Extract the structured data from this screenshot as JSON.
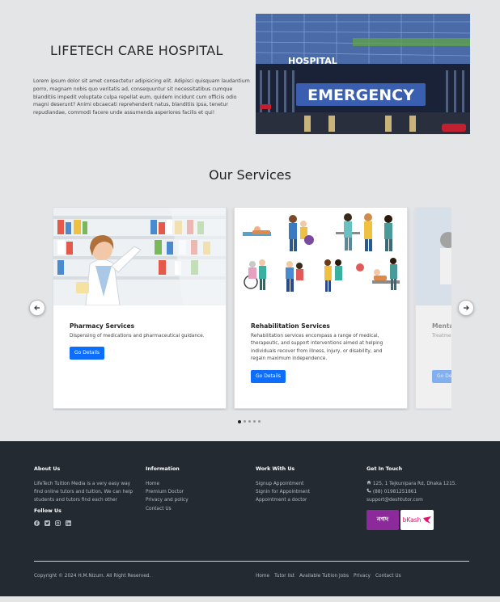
{
  "hero": {
    "title": "LIFETECH CARE HOSPITAL",
    "text": "Lorem ipsum dolor sit amet consectetur adipisicing elit. Adipisci quisquam laudantium porro, magnam nobis quo veritatis ad, consequuntur sit necessitatibus cumque blanditiis impedit voluptate culpa repellat eum, quidem incidunt cum officiis odio magni deserunt? Animi obcaecati reprehenderit natus, blanditiis ipsa, tenetur repudiandae, commodi facere unde assumenda asperiores facilis et qui!",
    "image_sign_top": "HOSPITAL",
    "image_sign_main": "EMERGENCY"
  },
  "services": {
    "title": "Our Services",
    "cards": [
      {
        "title": "Pharmacy Services",
        "description": "Dispensing of medications and pharmaceutical guidance.",
        "button": "Go Details"
      },
      {
        "title": "Rehabilitation Services",
        "description": "Rehabilitation services encompass a range of medical, therapeutic, and support interventions aimed at helping individuals recover from illness, injury, or disability, and regain maximum independence.",
        "button": "Go Details"
      },
      {
        "title": "Mental",
        "description": "Treatment Certainly profession mental h",
        "button": "Go Det"
      }
    ],
    "dot_count": 5,
    "active_dot": 0
  },
  "footer": {
    "about": {
      "heading": "About Us",
      "text": "LifeTech Tuition Media is a very easy way find online tutors and tuition, We can help students and tutors find each other",
      "follow": "Follow Us",
      "social_icons": [
        "facebook-icon",
        "twitter-icon",
        "instagram-icon",
        "linkedin-icon"
      ]
    },
    "information": {
      "heading": "Information",
      "links": [
        "Home",
        "Premium Doctor",
        "Privacy and policy",
        "Contact Us"
      ]
    },
    "work": {
      "heading": "Work With Us",
      "links": [
        "Signup Appointment",
        "Signin for Appointment",
        "Appointment a doctor"
      ]
    },
    "contact": {
      "heading": "Get In Touch",
      "address": "125, 1 Tejkunipara Rd, Dhaka 1215.",
      "phone": "(88) 01981251861",
      "email": "support@deshtutor.com",
      "payments": [
        "নগদ",
        "bKash"
      ]
    },
    "copyright": "Copyright © 2024 H.M.Nizum. All Right Reserved.",
    "bottom_links": [
      "Home",
      "Tutor list",
      "Available Tuition Jobs",
      "Privacy",
      "Contact Us"
    ]
  },
  "colors": {
    "accent": "#0d6efd",
    "footer_bg": "#242a31",
    "page_bg": "#e4e5e7",
    "nagad": "#8c2a9b",
    "bkash": "#e2136e"
  }
}
